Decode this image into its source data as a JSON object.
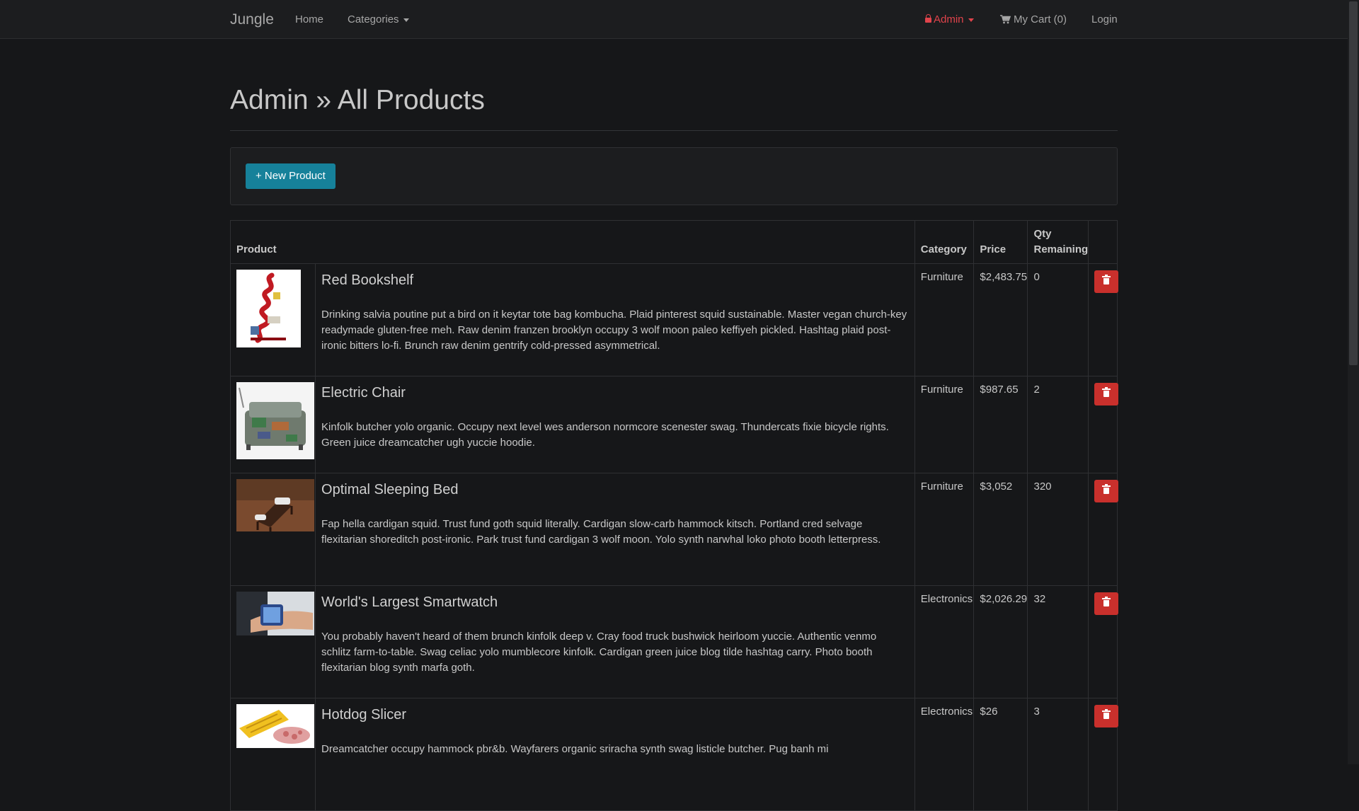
{
  "nav": {
    "brand": "Jungle",
    "home": "Home",
    "categories": "Categories",
    "admin": "Admin",
    "cart": "My Cart (0)",
    "login": "Login"
  },
  "page": {
    "title": "Admin » All Products",
    "new_product_label": "+ New Product"
  },
  "table": {
    "headers": {
      "product": "Product",
      "category": "Category",
      "price": "Price",
      "qty": "Qty Remaining"
    },
    "rows": [
      {
        "name": "Red Bookshelf",
        "description": "Drinking salvia poutine put a bird on it keytar tote bag kombucha. Plaid pinterest squid sustainable. Master vegan church-key readymade gluten-free meh. Raw denim franzen brooklyn occupy 3 wolf moon paleo keffiyeh pickled. Hashtag plaid post-ironic bitters lo-fi. Brunch raw denim gentrify cold-pressed asymmetrical.",
        "category": "Furniture",
        "price": "$2,483.75",
        "qty": "0"
      },
      {
        "name": "Electric Chair",
        "description": "Kinfolk butcher yolo organic. Occupy next level wes anderson normcore scenester swag. Thundercats fixie bicycle rights. Green juice dreamcatcher ugh yuccie hoodie.",
        "category": "Furniture",
        "price": "$987.65",
        "qty": "2"
      },
      {
        "name": "Optimal Sleeping Bed",
        "description": "Fap hella cardigan squid. Trust fund goth squid literally. Cardigan slow-carb hammock kitsch. Portland cred selvage flexitarian shoreditch post-ironic. Park trust fund cardigan 3 wolf moon. Yolo synth narwhal loko photo booth letterpress.",
        "category": "Furniture",
        "price": "$3,052",
        "qty": "320"
      },
      {
        "name": "World's Largest Smartwatch",
        "description": "You probably haven't heard of them brunch kinfolk deep v. Cray food truck bushwick heirloom yuccie. Authentic venmo schlitz farm-to-table. Swag celiac yolo mumblecore kinfolk. Cardigan green juice blog tilde hashtag carry. Photo booth flexitarian blog synth marfa goth.",
        "category": "Electronics",
        "price": "$2,026.29",
        "qty": "32"
      },
      {
        "name": "Hotdog Slicer",
        "description": "Dreamcatcher occupy hammock pbr&b. Wayfarers organic sriracha synth swag listicle butcher. Pug banh mi",
        "category": "Electronics",
        "price": "$26",
        "qty": "3"
      }
    ]
  },
  "colors": {
    "background": "#161719",
    "navbar": "#1c1d1f",
    "admin_accent": "#e0434b",
    "primary_button": "#16819a",
    "danger_button": "#c9302c"
  }
}
